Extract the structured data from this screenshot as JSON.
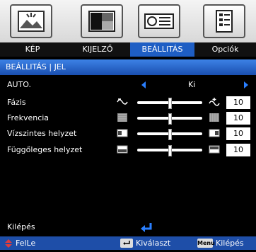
{
  "tabs": [
    {
      "label": "KÉP",
      "icon": "picture-icon",
      "active": false
    },
    {
      "label": "KIJELZŐ",
      "icon": "display-icon",
      "active": false
    },
    {
      "label": "BEÁLLITÁS",
      "icon": "projector-icon",
      "active": true
    },
    {
      "label": "Opciók",
      "icon": "options-icon",
      "active": false
    }
  ],
  "breadcrumb": "BEÁLLITÁS | JEL",
  "auto": {
    "label": "AUTO.",
    "value": "Ki"
  },
  "settings": [
    {
      "label": "Fázis",
      "value": "10",
      "level": 0.5,
      "icon_left": "phase-minus-icon",
      "icon_right": "phase-plus-icon"
    },
    {
      "label": "Frekvencia",
      "value": "10",
      "level": 0.5,
      "icon_left": "frequency-minus-icon",
      "icon_right": "frequency-plus-icon"
    },
    {
      "label": "Vízszintes helyzet",
      "value": "10",
      "level": 0.5,
      "icon_left": "horizontal-left-icon",
      "icon_right": "horizontal-right-icon"
    },
    {
      "label": "Függőleges helyzet",
      "value": "10",
      "level": 0.5,
      "icon_left": "vertical-down-icon",
      "icon_right": "vertical-up-icon"
    }
  ],
  "exit": {
    "label": "Kilépés"
  },
  "footer": {
    "updown": "FelLe",
    "select": "Kiválaszt",
    "menu_key": "Menu",
    "exit": "Kilépés"
  },
  "colors": {
    "accent": "#1e5ec4",
    "arrow": "#2a7fff",
    "footer": "#1e4ea8"
  }
}
